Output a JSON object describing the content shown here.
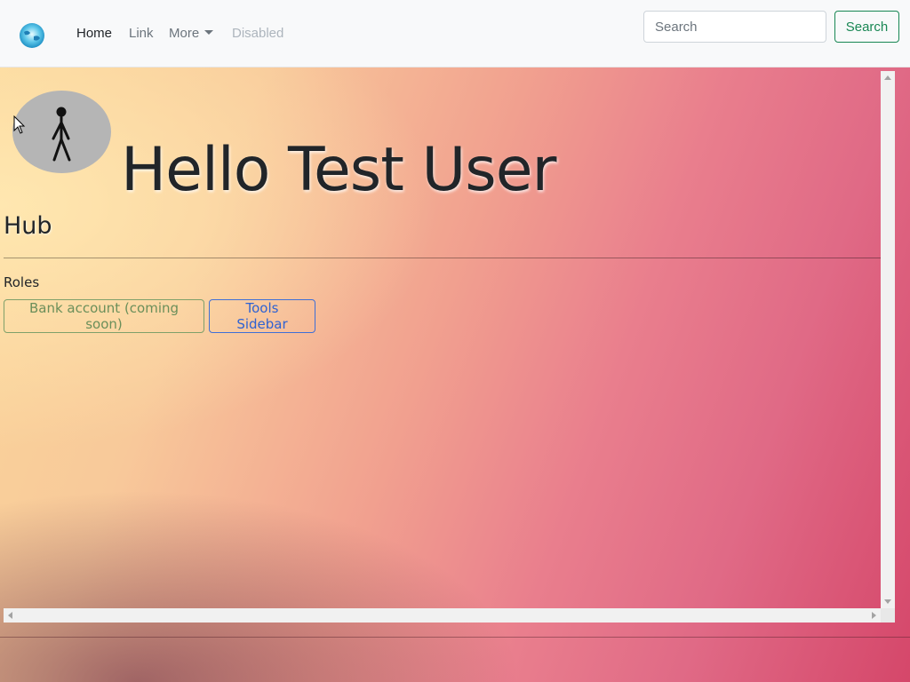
{
  "navbar": {
    "logo_icon": "globe-logo-icon",
    "links": [
      {
        "label": "Home",
        "state": "active"
      },
      {
        "label": "Link",
        "state": "normal"
      },
      {
        "label": "More",
        "state": "dropdown"
      },
      {
        "label": "Disabled",
        "state": "disabled"
      }
    ],
    "search": {
      "placeholder": "Search",
      "value": "",
      "button_label": "Search"
    }
  },
  "main": {
    "avatar_icon": "stick-figure-icon",
    "greeting": "Hello Test User",
    "hub_title": "Hub",
    "roles_label": "Roles",
    "role_buttons": [
      {
        "label": "Bank account (coming soon)",
        "color": "#6b8f5a"
      },
      {
        "label": "Tools Sidebar",
        "color": "#2f62d2"
      }
    ]
  },
  "colors": {
    "navbar_bg": "#f8f9fa",
    "search_button": "#198754",
    "text_dark": "#212529"
  }
}
